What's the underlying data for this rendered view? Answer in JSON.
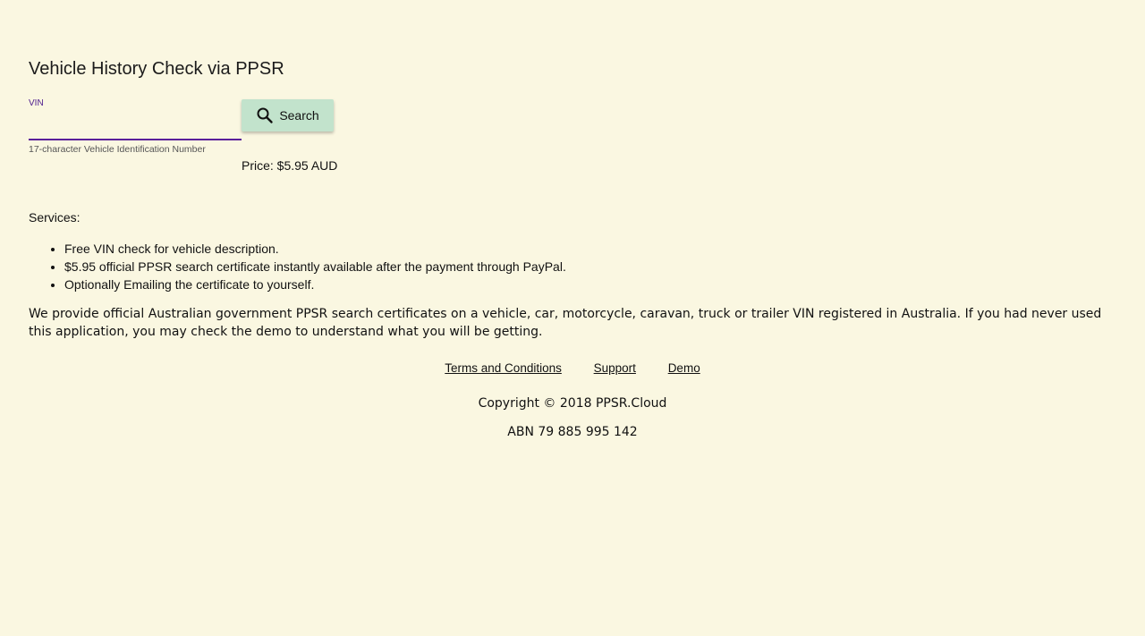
{
  "page": {
    "title": "Vehicle History Check via PPSR",
    "background_color": "#faf7e1"
  },
  "vin_field": {
    "label": "VIN",
    "value": "",
    "help_text": "17-character Vehicle Identification Number",
    "underline_color": "#5a1f9a"
  },
  "search_button": {
    "label": "Search",
    "icon": "search-icon",
    "background_color": "#c2e3cc"
  },
  "price": {
    "text": "Price: $5.95 AUD"
  },
  "services": {
    "title": "Services:",
    "items": [
      "Free VIN check for vehicle description.",
      "$5.95 official PPSR search certificate instantly available after the payment through PayPal.",
      "Optionally Emailing the certificate to yourself."
    ]
  },
  "description": "We provide official Australian government PPSR search certificates on a vehicle, car, motorcycle, caravan, truck or trailer VIN registered in Australia. If you had never used this application, you may check the demo to understand what you will be getting.",
  "footer": {
    "links": [
      "Terms and Conditions",
      "Support",
      "Demo"
    ],
    "copyright": "Copyright © 2018 PPSR.Cloud",
    "abn": "ABN 79 885 995 142"
  }
}
